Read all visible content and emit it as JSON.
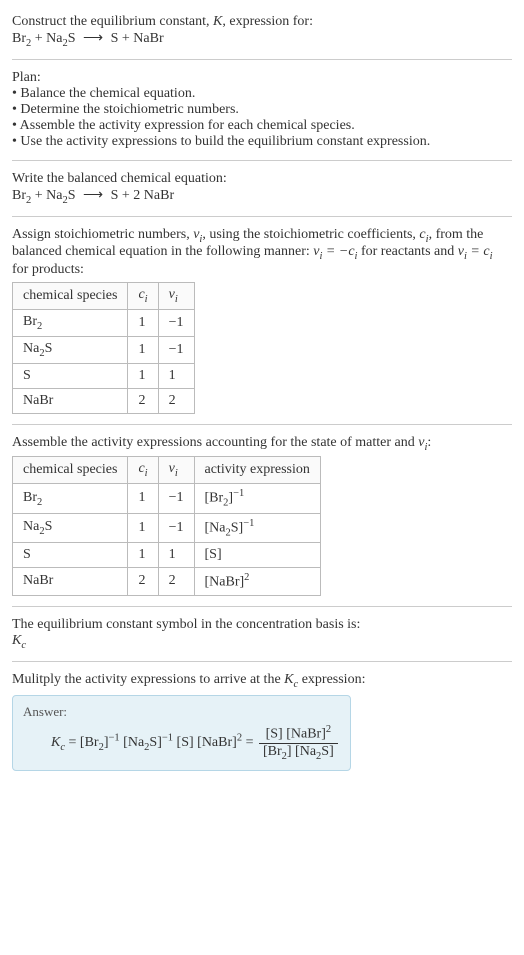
{
  "header": {
    "line1": "Construct the equilibrium constant, ",
    "k": "K",
    "line1b": ", expression for:",
    "equationLhs": "Br",
    "equationLhsSub": "2",
    "plus1": " + Na",
    "plus1Sub": "2",
    "plus1b": "S",
    "arrow": "⟶",
    "rhs": "S + NaBr"
  },
  "plan": {
    "title": "Plan:",
    "items": [
      "• Balance the chemical equation.",
      "• Determine the stoichiometric numbers.",
      "• Assemble the activity expression for each chemical species.",
      "• Use the activity expressions to build the equilibrium constant expression."
    ]
  },
  "balanced": {
    "intro": "Write the balanced chemical equation:",
    "lhs1": "Br",
    "lhs1Sub": "2",
    "plus": " + Na",
    "plusSub": "2",
    "plusB": "S",
    "arrow": "⟶",
    "rhs": "S + 2 NaBr"
  },
  "assign": {
    "text1": "Assign stoichiometric numbers, ",
    "vi": "ν",
    "isub": "i",
    "text2": ", using the stoichiometric coefficients, ",
    "ci": "c",
    "text3": ", from the balanced chemical equation in the following manner: ",
    "eq1a": "ν",
    "eq1b": " = −c",
    "text4": " for reactants and ",
    "eq2a": "ν",
    "eq2b": " = c",
    "text5": " for products:"
  },
  "table1": {
    "headers": {
      "h1": "chemical species",
      "h2": "c",
      "h2sub": "i",
      "h3": "ν",
      "h3sub": "i"
    },
    "rows": [
      {
        "sp": "Br",
        "spSub": "2",
        "c": "1",
        "v": "−1"
      },
      {
        "sp": "Na",
        "spSub": "2",
        "spTail": "S",
        "c": "1",
        "v": "−1"
      },
      {
        "sp": "S",
        "spSub": "",
        "c": "1",
        "v": "1"
      },
      {
        "sp": "NaBr",
        "spSub": "",
        "c": "2",
        "v": "2"
      }
    ]
  },
  "assemble": {
    "text": "Assemble the activity expressions accounting for the state of matter and ",
    "vi": "ν",
    "isub": "i",
    "colon": ":"
  },
  "table2": {
    "headers": {
      "h1": "chemical species",
      "h2": "c",
      "h2sub": "i",
      "h3": "ν",
      "h3sub": "i",
      "h4": "activity expression"
    },
    "rows": [
      {
        "sp": "Br",
        "spSub": "2",
        "c": "1",
        "v": "−1",
        "act": "[Br",
        "actSub": "2",
        "actTail": "]",
        "actSup": "−1"
      },
      {
        "sp": "Na",
        "spSub": "2",
        "spTail": "S",
        "c": "1",
        "v": "−1",
        "act": "[Na",
        "actSub": "2",
        "actTail": "S]",
        "actSup": "−1"
      },
      {
        "sp": "S",
        "spSub": "",
        "c": "1",
        "v": "1",
        "act": "[S]",
        "actSub": "",
        "actTail": "",
        "actSup": ""
      },
      {
        "sp": "NaBr",
        "spSub": "",
        "c": "2",
        "v": "2",
        "act": "[NaBr]",
        "actSub": "",
        "actTail": "",
        "actSup": "2"
      }
    ]
  },
  "basis": {
    "text": "The equilibrium constant symbol in the concentration basis is:",
    "symbol": "K",
    "sub": "c"
  },
  "multiply": {
    "text": "Mulitply the activity expressions to arrive at the ",
    "k": "K",
    "ksub": "c",
    "text2": " expression:"
  },
  "answer": {
    "label": "Answer:",
    "lhs": "K",
    "lhsSub": "c",
    "eq": " = [Br",
    "br2sub": "2",
    "eq2": "]",
    "sup1": "−1",
    "eq3": " [Na",
    "na2sub": "2",
    "eq4": "S]",
    "sup2": "−1",
    "eq5": " [S] [NaBr]",
    "sup3": "2",
    "eq6": " = ",
    "num": "[S] [NaBr]",
    "numSup": "2",
    "den1": "[Br",
    "den1sub": "2",
    "den2": "] [Na",
    "den2sub": "2",
    "den3": "S]"
  }
}
